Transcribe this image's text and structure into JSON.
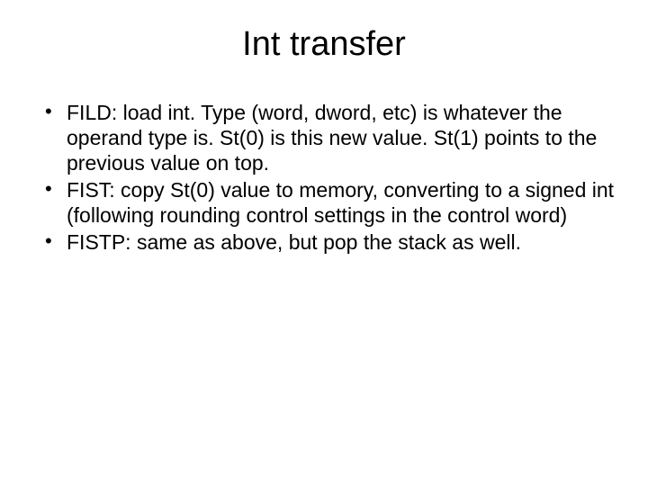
{
  "slide": {
    "title": "Int transfer",
    "bullets": [
      "FILD: load int.  Type (word, dword, etc) is whatever the operand type is.  St(0) is this new value.  St(1) points to the previous value on top.",
      "FIST: copy St(0) value to memory, converting to a signed int (following rounding control settings in the control word)",
      "FISTP: same as above, but pop the stack as well."
    ]
  }
}
